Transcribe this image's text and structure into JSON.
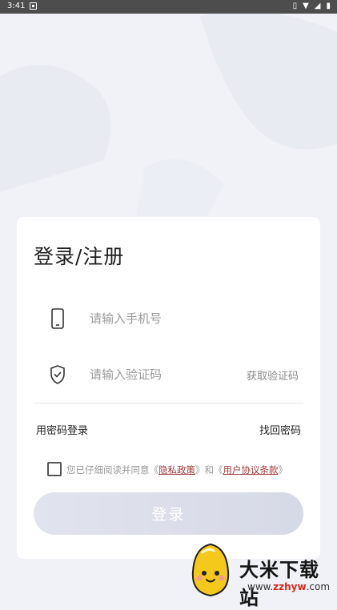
{
  "status_bar": {
    "time": "3:41",
    "icons": [
      "notification-icon",
      "vibrate-icon",
      "wifi-icon",
      "signal-icon",
      "battery-icon"
    ]
  },
  "login": {
    "title": "登录/注册",
    "phone_placeholder": "请输入手机号",
    "code_placeholder": "请输入验证码",
    "get_code": "获取验证码",
    "password_login": "用密码登录",
    "recover_password": "找回密码",
    "agreement": {
      "prefix": "您已仔细阅读并同意《",
      "privacy": "隐私政策",
      "middle": "》和《",
      "terms": "用户协议条款",
      "suffix": "》",
      "checked": false
    },
    "submit": "登录"
  },
  "watermark": {
    "brand": "大米下载站",
    "url_prefix": "www.",
    "url_highlight": "zzhyw",
    "url_suffix": ".com"
  },
  "colors": {
    "background": "#f1f2f7",
    "card": "#ffffff",
    "button_gradient_start": "#e1e4ee",
    "button_gradient_end": "#d6d9e6",
    "link": "#a33a3a",
    "placeholder": "#9a9a9a"
  }
}
